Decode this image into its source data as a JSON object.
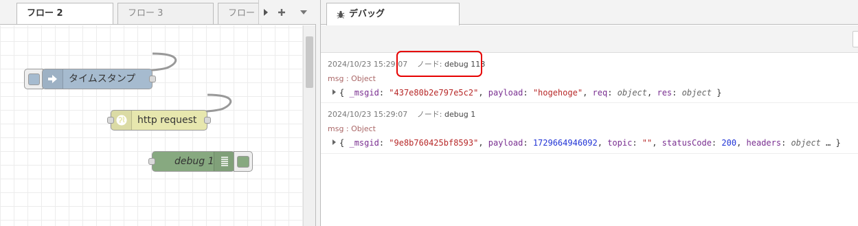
{
  "workspace": {
    "tabs": [
      {
        "label": "フロー 2",
        "active": true
      },
      {
        "label": "フロー 3",
        "active": false
      },
      {
        "label": "フロー",
        "active": false
      }
    ],
    "nodes": {
      "inject": {
        "label": "タイムスタンプ",
        "color": "#a6bbcf"
      },
      "http": {
        "label": "http request",
        "color": "#e7e7ae"
      },
      "debug": {
        "label": "debug 1",
        "color": "#87a980"
      }
    }
  },
  "sidebar": {
    "tab_label": "デバッグ",
    "messages": [
      {
        "timestamp": "2024/10/23 15:29:07",
        "node_prefix": "ノード:",
        "node_name": "debug 118",
        "topic": "msg : Object",
        "body": {
          "open": "{",
          "k1": "_msgid",
          "v1": "\"437e80b2e797e5c2\"",
          "k2": "payload",
          "v2": "\"hogehoge\"",
          "k3": "req",
          "v3": "object",
          "k4": "res",
          "v4": "object",
          "close": "}"
        }
      },
      {
        "timestamp": "2024/10/23 15:29:07",
        "node_prefix": "ノード:",
        "node_name": "debug 1",
        "topic": "msg : Object",
        "body": {
          "open": "{",
          "k1": "_msgid",
          "v1": "\"9e8b760425bf8593\"",
          "k2": "payload",
          "v2": "1729664946092",
          "k3": "topic",
          "v3": "\"\"",
          "k4": "statusCode",
          "v4": "200",
          "k5": "headers",
          "v5": "object",
          "ellipsis": "…",
          "close": "}"
        }
      }
    ]
  }
}
